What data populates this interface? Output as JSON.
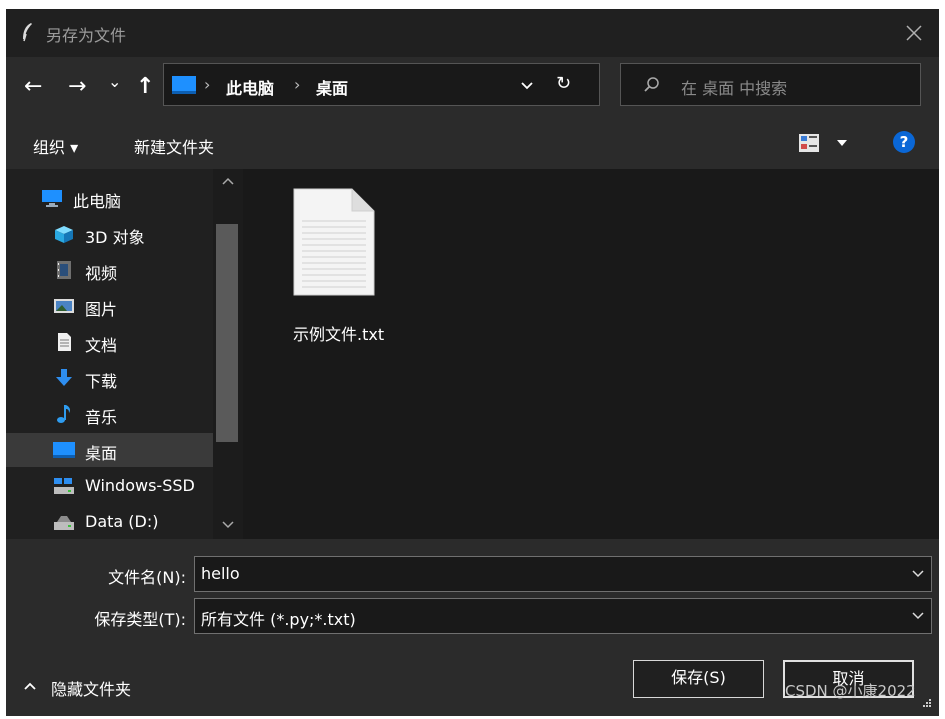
{
  "window": {
    "title": "另存为文件"
  },
  "nav": {
    "back_icon": "←",
    "forward_icon": "→",
    "recent_icon": "⌄",
    "up_icon": "↑",
    "breadcrumb": [
      "此电脑",
      "桌面"
    ],
    "refresh_icon": "↻",
    "search_placeholder": "在 桌面 中搜索"
  },
  "toolbar": {
    "organize_label": "组织 ▾",
    "new_folder_label": "新建文件夹",
    "help_label": "?"
  },
  "sidebar": {
    "items": [
      {
        "label": "此电脑",
        "icon": "computer-icon"
      },
      {
        "label": "3D 对象",
        "icon": "cube-icon"
      },
      {
        "label": "视频",
        "icon": "video-icon"
      },
      {
        "label": "图片",
        "icon": "picture-icon"
      },
      {
        "label": "文档",
        "icon": "document-icon"
      },
      {
        "label": "下载",
        "icon": "download-icon"
      },
      {
        "label": "音乐",
        "icon": "music-icon"
      },
      {
        "label": "桌面",
        "icon": "desktop-icon",
        "selected": true
      },
      {
        "label": "Windows-SSD",
        "icon": "drive-icon"
      },
      {
        "label": "Data (D:)",
        "icon": "drive-icon"
      }
    ]
  },
  "files": [
    {
      "name": "示例文件.txt",
      "icon": "text-file-icon"
    }
  ],
  "form": {
    "filename_label": "文件名(N):",
    "filename_value": "hello",
    "filetype_label": "保存类型(T):",
    "filetype_value": "所有文件 (*.py;*.txt)"
  },
  "footer": {
    "hide_folders_label": "隐藏文件夹",
    "save_label": "保存(S)",
    "cancel_label": "取消",
    "watermark": "CSDN @小康2022"
  },
  "colors": {
    "background": "#202020",
    "panel": "#2b2b2b",
    "accent": "#1e90ff",
    "help": "#0a67d6"
  }
}
